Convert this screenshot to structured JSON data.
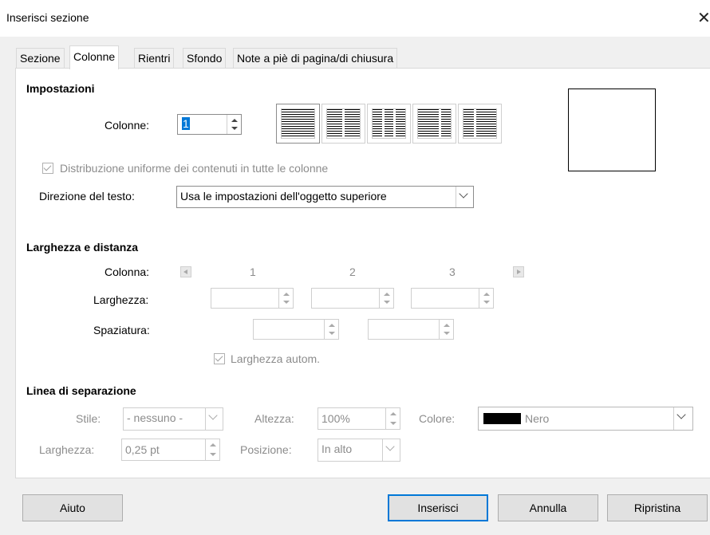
{
  "window": {
    "title": "Inserisci sezione",
    "close_glyph": "✕"
  },
  "tabs": [
    {
      "label": "Sezione"
    },
    {
      "label": "Colonne",
      "active": true
    },
    {
      "label": "Rientri"
    },
    {
      "label": "Sfondo"
    },
    {
      "label": "Note a piè di pagina/di chiusura"
    }
  ],
  "settings": {
    "header": "Impostazioni",
    "columns_label": "Colonne:",
    "columns_value": "1",
    "layouts": [
      {
        "icon": "one-column-layout-icon",
        "selected": true
      },
      {
        "icon": "two-column-layout-icon"
      },
      {
        "icon": "three-column-layout-icon"
      },
      {
        "icon": "left-wide-layout-icon"
      },
      {
        "icon": "right-wide-layout-icon"
      }
    ],
    "even_distribution_label": "Distribuzione uniforme dei contenuti in tutte le colonne",
    "even_distribution_checked": true,
    "text_direction_label": "Direzione del testo:",
    "text_direction_value": "Usa le impostazioni dell'oggetto superiore"
  },
  "width_spacing": {
    "header": "Larghezza e distanza",
    "column_label": "Colonna:",
    "column_numbers": [
      "1",
      "2",
      "3"
    ],
    "width_label": "Larghezza:",
    "spacing_label": "Spaziatura:",
    "auto_width_label": "Larghezza autom.",
    "auto_width_checked": true
  },
  "separator": {
    "header": "Linea di separazione",
    "style_label": "Stile:",
    "style_value": "- nessuno -",
    "height_label": "Altezza:",
    "height_value": "100%",
    "color_label": "Colore:",
    "color_value": "Nero",
    "color_swatch": "#000000",
    "width_label": "Larghezza:",
    "width_value": "0,25 pt",
    "position_label": "Posizione:",
    "position_value": "In alto"
  },
  "buttons": {
    "help": "Aiuto",
    "insert": "Inserisci",
    "cancel": "Annulla",
    "reset": "Ripristina"
  }
}
